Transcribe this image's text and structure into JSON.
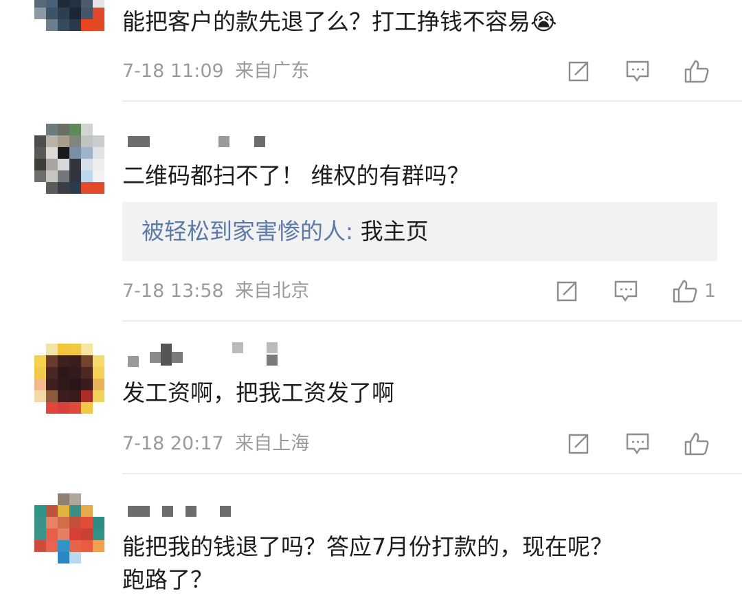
{
  "comments": [
    {
      "text": "能把客户的款先退了么？打工挣钱不容易😭",
      "time": "7-18 11:09",
      "location": "来自广东",
      "likes": ""
    },
    {
      "text": "二维码都扫不了！ 维权的有群吗？",
      "reply": {
        "name": "被轻松到家害惨的人",
        "separator": ": ",
        "text": "我主页"
      },
      "time": "7-18 13:58",
      "location": "来自北京",
      "likes": "1"
    },
    {
      "text": "发工资啊，把我工资发了啊",
      "time": "7-18 20:17",
      "location": "来自上海",
      "likes": ""
    },
    {
      "text": "能把我的钱退了吗？答应7月份打款的，现在呢？\n跑路了？"
    }
  ],
  "icons": {
    "repost": "repost-icon",
    "comment": "comment-icon",
    "like": "thumbs-up-icon"
  },
  "colors": {
    "text": "#1d1d1d",
    "meta": "#9a9a9a",
    "reply_name": "#5b7aa8",
    "reply_bg": "#f2f2f2",
    "divider": "#ececec"
  }
}
